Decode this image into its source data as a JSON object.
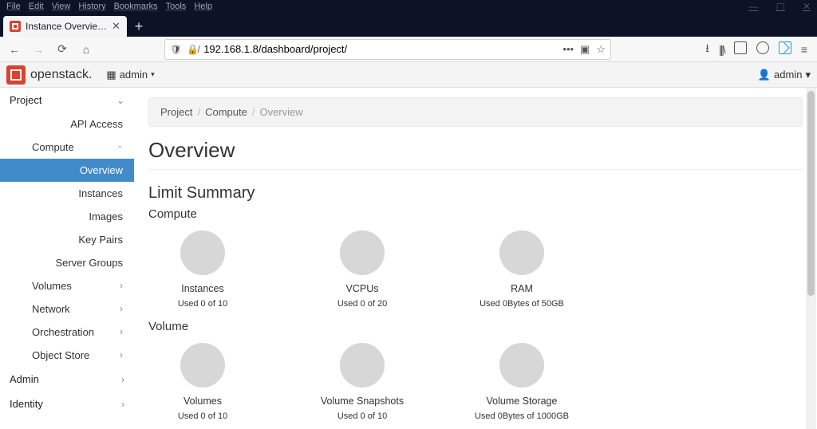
{
  "menubar": {
    "items": [
      "File",
      "Edit",
      "View",
      "History",
      "Bookmarks",
      "Tools",
      "Help"
    ]
  },
  "tab": {
    "title": "Instance Overview - OpenStack"
  },
  "url": "192.168.1.8/dashboard/project/",
  "os_header": {
    "brand": "openstack.",
    "domain_dd": "admin",
    "user_dd": "admin"
  },
  "sidebar": {
    "project_label": "Project",
    "api_access": "API Access",
    "compute_label": "Compute",
    "compute_items": [
      "Overview",
      "Instances",
      "Images",
      "Key Pairs",
      "Server Groups"
    ],
    "groups": [
      "Volumes",
      "Network",
      "Orchestration",
      "Object Store"
    ],
    "admin_label": "Admin",
    "identity_label": "Identity"
  },
  "breadcrumb": {
    "a": "Project",
    "b": "Compute",
    "c": "Overview"
  },
  "page_title": "Overview",
  "limit_summary": "Limit Summary",
  "compute_section": {
    "title": "Compute",
    "cards": [
      {
        "name": "Instances",
        "used": "Used 0 of 10"
      },
      {
        "name": "VCPUs",
        "used": "Used 0 of 20"
      },
      {
        "name": "RAM",
        "used": "Used 0Bytes of 50GB"
      }
    ]
  },
  "volume_section": {
    "title": "Volume",
    "cards": [
      {
        "name": "Volumes",
        "used": "Used 0 of 10"
      },
      {
        "name": "Volume Snapshots",
        "used": "Used 0 of 10"
      },
      {
        "name": "Volume Storage",
        "used": "Used 0Bytes of 1000GB"
      }
    ]
  }
}
